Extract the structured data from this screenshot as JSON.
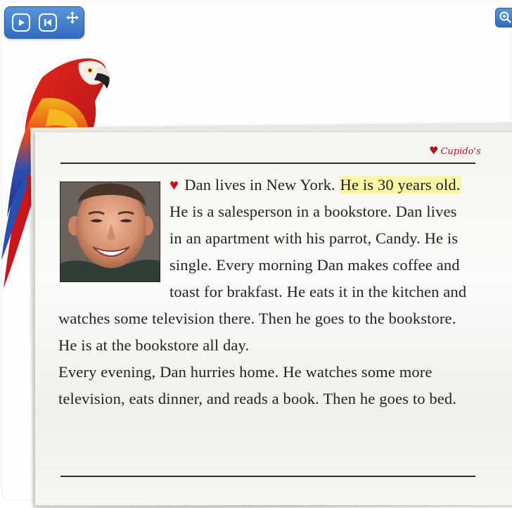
{
  "toolbar": {
    "play_icon": "play-icon",
    "restart_icon": "restart-icon",
    "move_icon": "move-icon",
    "zoom_icon": "zoom-in-icon"
  },
  "newspaper": {
    "brand": "Cupido's",
    "heart": "♥",
    "article": {
      "part1": "Dan lives in New York.",
      "highlight": "He is 30 years old.",
      "part2": "He is a salesperson in a bookstore. Dan lives in an apartment with his parrot, Candy. He is single. Every morning Dan makes coffee and toast for brakfast. He eats it in the kitchen and watches some television there. Then he goes to the bookstore. He is at the bookstore all day.",
      "part3": "Every evening, Dan hurries home. He watches some more television, eats dinner, and reads a book. Then he goes to bed."
    }
  },
  "colors": {
    "accent_blue": "#3a78c8",
    "heart_red": "#c0151d",
    "highlight": "#fbf5a6"
  }
}
